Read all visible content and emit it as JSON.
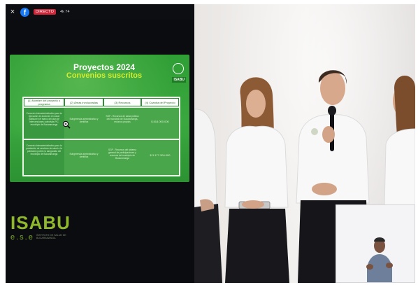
{
  "player": {
    "close_glyph": "×",
    "platform_icon": "facebook-icon",
    "live_label": "DIRECTO",
    "viewers": "4k 74"
  },
  "slide": {
    "title": "Proyectos 2024",
    "subtitle": "Convenios suscritos",
    "logo_text": "ISABU",
    "columns": [
      "(1) Nombre del proyecto o programa",
      "(2) Áreas involucradas",
      "(3) Recursos",
      "(4) Cuantía del Proyecto"
    ],
    "rows": [
      {
        "c1": "Convenio interadministrativo para la ejecución de acciones en salud pública en el marco del plan de intervenciones colectivas PIC municipio de Bucaramanga",
        "c2": "Subgerencia administrativa y científica",
        "c3": "SGP - Recursos de salud pública del municipio de Bucaramanga, recursos propios",
        "c4": "$ 818.000.000"
      },
      {
        "c1": "Convenio interadministrativo para la prestación de servicios de salud a la población pobre no asegurada del municipio de Bucaramanga",
        "c2": "Subgerencia administrativa y científica",
        "c3": "SGP - Recursos del sistema general de participaciones y recursos del municipio de Bucaramanga",
        "c4": "$ 3.177.304.000"
      }
    ],
    "colors": {
      "green": "#36a23c",
      "accent": "#d6ec2a"
    }
  },
  "brand": {
    "logo_is": "ISA",
    "logo_bu": "BU",
    "ese": "e.s.e",
    "caption": "INSTITUTO DE SALUD DE BUCARAMANGA"
  }
}
